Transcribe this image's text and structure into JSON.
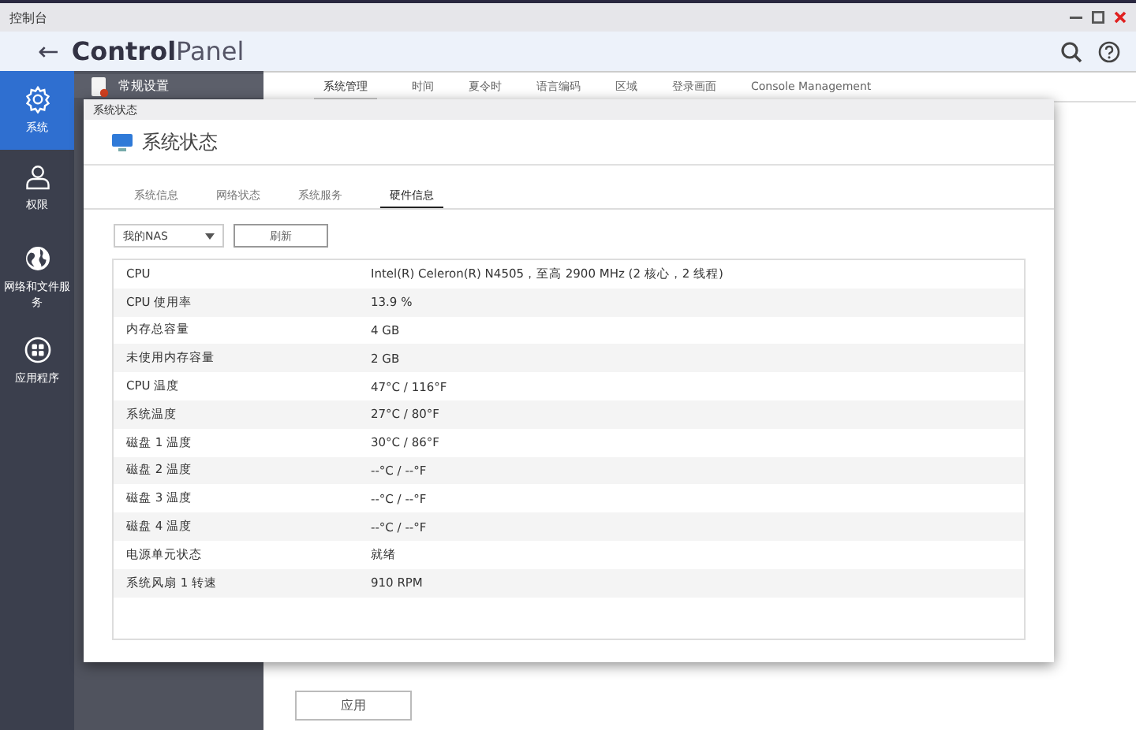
{
  "window": {
    "title": "控制台"
  },
  "header": {
    "back": "←",
    "logo": "**Control**Panel"
  },
  "sidebar": {
    "items": [
      {
        "label": "系统",
        "selected": true
      },
      {
        "label": "权限",
        "selected": false
      },
      {
        "label": "网络和文件服务",
        "selected": false
      },
      {
        "label": "应用程序",
        "selected": false
      }
    ]
  },
  "submenu": {
    "items": [
      {
        "label": "常规设置",
        "selected": true
      }
    ]
  },
  "tabs": [
    {
      "label": "系统管理",
      "selected": true
    },
    {
      "label": "时间",
      "selected": false
    },
    {
      "label": "夏令时",
      "selected": false
    },
    {
      "label": "语言编码",
      "selected": false
    },
    {
      "label": "区域",
      "selected": false
    },
    {
      "label": "登录画面",
      "selected": false
    },
    {
      "label": "Console Management",
      "selected": false
    }
  ],
  "apply_button": "应用",
  "dialog": {
    "caption": "系统状态",
    "title": "系统状态",
    "tabs": [
      {
        "label": "系统信息",
        "selected": false
      },
      {
        "label": "网络状态",
        "selected": false
      },
      {
        "label": "系统服务",
        "selected": false
      },
      {
        "label": "硬件信息",
        "selected": true
      }
    ],
    "device_select": {
      "value": "我的NAS"
    },
    "refresh_button": "刷新",
    "rows": [
      {
        "name": "CPU",
        "value": "Intel(R) Celeron(R) N4505，至高 2900 MHz (2 核心，2 线程)"
      },
      {
        "name": "CPU 使用率",
        "value": "13.9 %"
      },
      {
        "name": "内存总容量",
        "value": "4 GB"
      },
      {
        "name": "未使用内存容量",
        "value": "2 GB"
      },
      {
        "name": "CPU 温度",
        "value": "47°C / 116°F"
      },
      {
        "name": "系统温度",
        "value": "27°C / 80°F"
      },
      {
        "name": "磁盘 1 温度",
        "value": "30°C / 86°F"
      },
      {
        "name": "磁盘 2 温度",
        "value": "--°C / --°F"
      },
      {
        "name": "磁盘 3 温度",
        "value": "--°C / --°F"
      },
      {
        "name": "磁盘 4 温度",
        "value": "--°C / --°F"
      },
      {
        "name": "电源单元状态",
        "value": "就绪"
      },
      {
        "name": "系统风扇 1 转速",
        "value": "910 RPM"
      }
    ]
  }
}
